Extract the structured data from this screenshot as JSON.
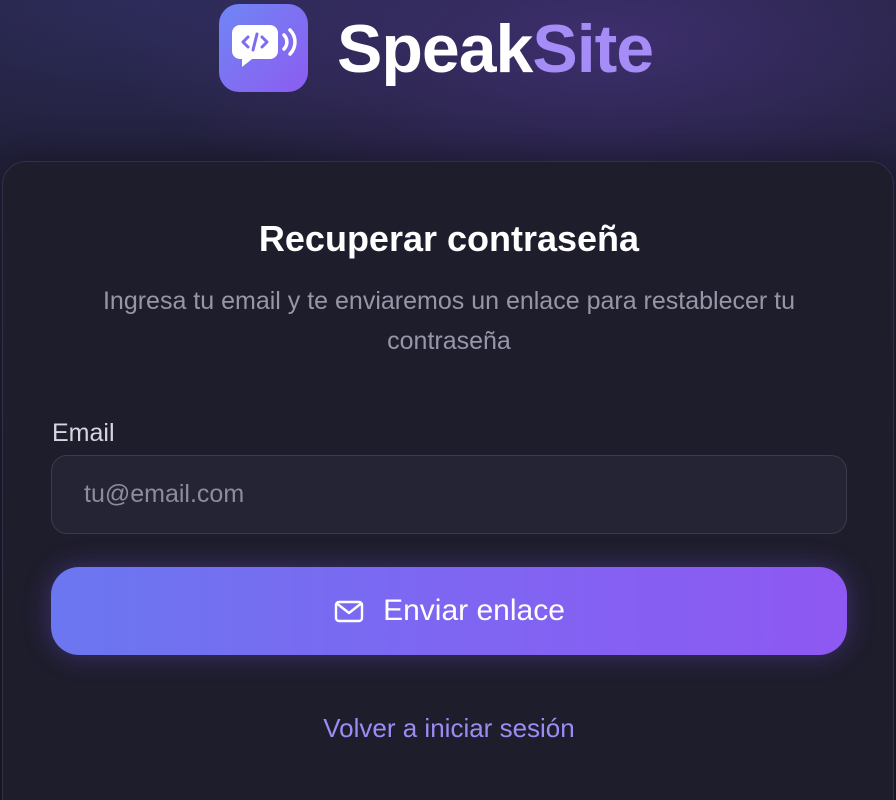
{
  "header": {
    "logo_icon": "speech-bubble-code-icon",
    "brand_part1": "Speak",
    "brand_part2": "Site",
    "accent_color": "#a58cf7"
  },
  "card": {
    "title": "Recuperar contraseña",
    "subtitle": "Ingresa tu email y te enviaremos un enlace para restablecer tu contraseña",
    "email_label": "Email",
    "email_placeholder": "tu@email.com",
    "email_value": "",
    "submit_icon": "mail-icon",
    "submit_label": "Enviar enlace",
    "back_link": "Volver a iniciar sesión"
  },
  "colors": {
    "button_start": "#6b77f0",
    "button_end": "#8e58f2",
    "link": "#9b8cf5",
    "background": "#1c1b2e"
  }
}
